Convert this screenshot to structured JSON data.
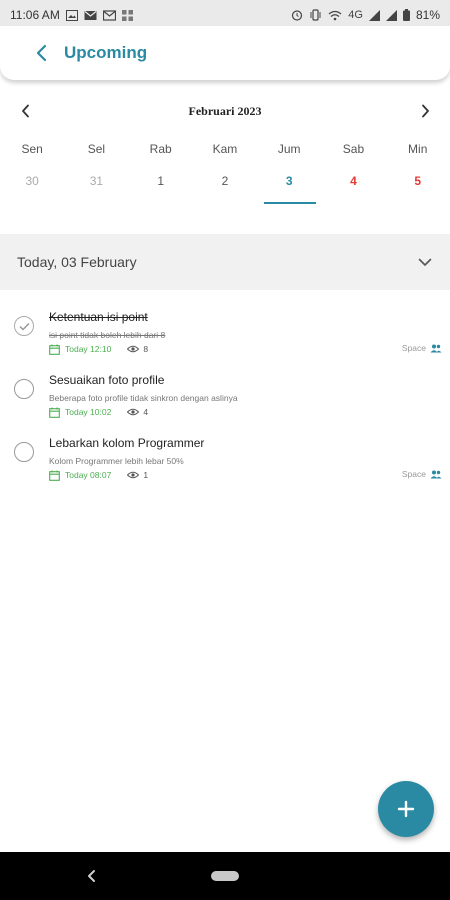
{
  "status_bar": {
    "time": "11:06 AM",
    "network": "4G",
    "battery": "81%",
    "left_icons": [
      "image-icon",
      "mail-icon",
      "gmail-icon",
      "grid-icon"
    ],
    "right_icons": [
      "alarm-icon",
      "vibrate-icon",
      "wifi-icon",
      "signal-icon",
      "signal-icon",
      "battery-icon"
    ]
  },
  "header": {
    "title": "Upcoming"
  },
  "calendar": {
    "month": "Februari 2023",
    "weekdays": [
      "Sen",
      "Sel",
      "Rab",
      "Kam",
      "Jum",
      "Sab",
      "Min"
    ],
    "days": [
      "30",
      "31",
      "1",
      "2",
      "3",
      "4",
      "5"
    ],
    "selected_day": "3",
    "colors": {
      "accent": "#2a8aa3",
      "weekend": "#e53935",
      "muted": "#aaaaaa"
    }
  },
  "section": {
    "title": "Today, 03 February"
  },
  "tasks": [
    {
      "title": "Ketentuan isi point",
      "description": "isi point tidak boleh lebih dari 8",
      "date": "Today 12:10",
      "views": "8",
      "space": "Space",
      "completed": true
    },
    {
      "title": "Sesuaikan foto profile",
      "description": "Beberapa foto profile tidak sinkron dengan aslinya",
      "date": "Today 10:02",
      "views": "4",
      "space": "",
      "completed": false
    },
    {
      "title": "Lebarkan kolom Programmer",
      "description": "Kolom Programmer lebih lebar 50%",
      "date": "Today 08:07",
      "views": "1",
      "space": "Space",
      "completed": false
    }
  ],
  "colors": {
    "brand": "#2a8aa3",
    "date_green": "#4caf50",
    "section_bg": "#f1f1f1"
  }
}
